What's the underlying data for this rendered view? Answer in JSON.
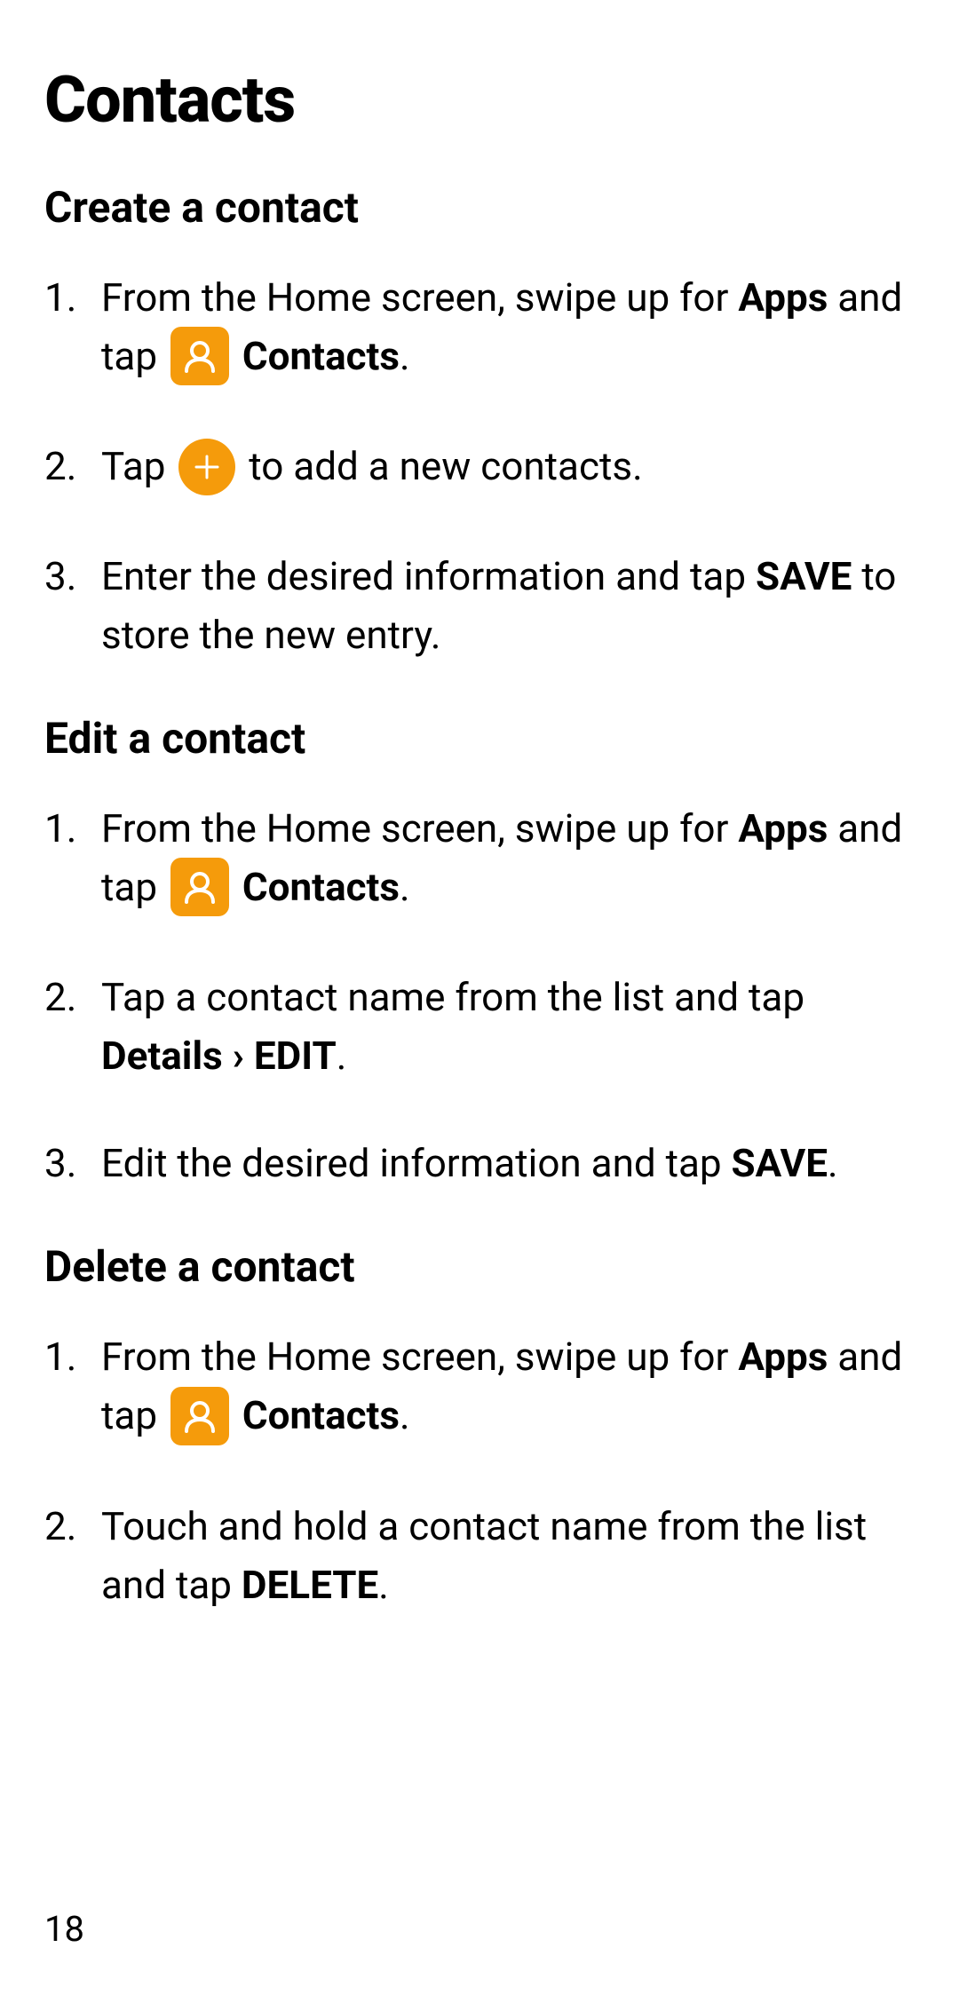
{
  "colors": {
    "accent": "#F59B0B",
    "icon_fg": "#FFFFFF"
  },
  "page_title": "Contacts",
  "sections": {
    "create": {
      "heading": "Create a contact",
      "step1_a": "From the Home screen, swipe up for ",
      "step1_apps": "Apps",
      "step1_b": " and tap ",
      "step1_contacts": " Contacts",
      "step1_end": ".",
      "step2_a": "Tap ",
      "step2_b": " to add a new contacts.",
      "step3_a": "Enter the desired information and tap ",
      "step3_save": "SAVE",
      "step3_b": " to store the new entry."
    },
    "edit": {
      "heading": "Edit a contact",
      "step1_a": "From the Home screen, swipe up for ",
      "step1_apps": "Apps",
      "step1_b": " and tap ",
      "step1_contacts": " Contacts",
      "step1_end": ".",
      "step2_a": "Tap a contact name from the list and tap ",
      "step2_details": "Details",
      "step2_sep": " › ",
      "step2_edit": "EDIT",
      "step2_end": ".",
      "step3_a": "Edit the desired information and tap ",
      "step3_save": "SAVE",
      "step3_end": "."
    },
    "delete": {
      "heading": "Delete a contact",
      "step1_a": "From the Home screen, swipe up for ",
      "step1_apps": "Apps",
      "step1_b": " and tap ",
      "step1_contacts": " Contacts",
      "step1_end": ".",
      "step2_a": "Touch and hold a contact name from the list and tap ",
      "step2_delete": "DELETE",
      "step2_end": "."
    }
  },
  "page_number": "18",
  "icons": {
    "contacts": "contacts-icon",
    "add": "add-icon"
  }
}
